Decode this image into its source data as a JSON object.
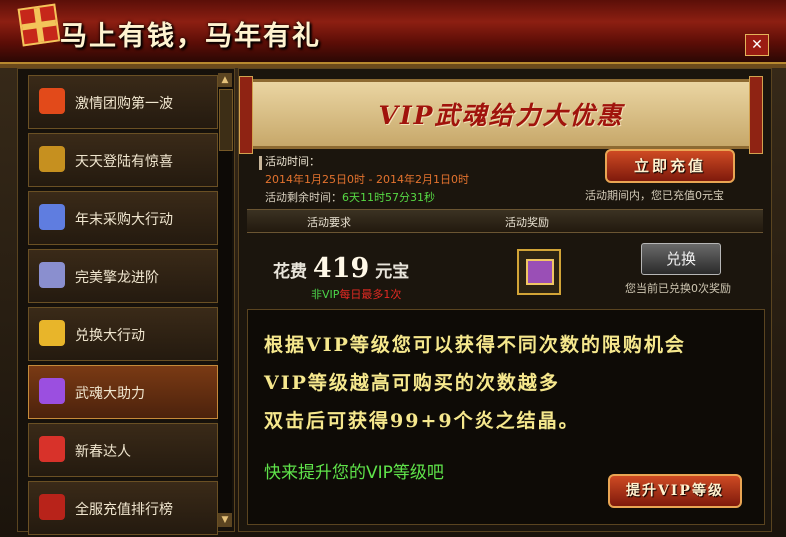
{
  "window": {
    "title": "马上有钱，马年有礼",
    "close_glyph": "✕"
  },
  "sidebar": {
    "items": [
      {
        "label": "激情团购第一波",
        "icon": "group-buy-icon",
        "color": "#e24a1a"
      },
      {
        "label": "天天登陆有惊喜",
        "icon": "star-ribbon-icon",
        "color": "#c6901f"
      },
      {
        "label": "年末采购大行动",
        "icon": "potion-bottle-icon",
        "color": "#5f7de0"
      },
      {
        "label": "完美擎龙进阶",
        "icon": "mage-figure-icon",
        "color": "#8a8fcf"
      },
      {
        "label": "兑换大行动",
        "icon": "gold-ingot-icon",
        "color": "#e8b52a"
      },
      {
        "label": "武魂大助力",
        "icon": "purple-orb-icon",
        "color": "#9b4fe0",
        "active": true
      },
      {
        "label": "新春达人",
        "icon": "red-bag-icon",
        "color": "#d8322a"
      },
      {
        "label": "全服充值排行榜",
        "icon": "red-banner-icon",
        "color": "#b8231a"
      }
    ]
  },
  "banner": {
    "title": "VIP武魂给力大优惠"
  },
  "activity": {
    "time_label": "活动时间：",
    "time_range": "2014年1月25日0时 - 2014年2月1日0时",
    "remain_label": "活动剩余时间：",
    "remain_value": "6天11时57分31秒",
    "recharge_button": "立即充值",
    "recharge_note": "活动期间内，您已充值0元宝"
  },
  "table": {
    "col_requirement": "活动要求",
    "col_reward": "活动奖励",
    "cost_prefix": "花费",
    "cost_value": "419",
    "cost_unit": "元宝",
    "limit_vip": "非VIP",
    "limit_text": "每日最多1次",
    "reward_icon": "treasure-chest-icon",
    "exchange_button": "兑换",
    "exchange_note": "您当前已兑换0次奖励"
  },
  "description": {
    "line1": "根据VIP等级您可以获得不同次数的限购机会",
    "line2": "VIP等级越高可购买的次数越多",
    "line3": "双击后可获得99+9个炎之结晶。",
    "cta": "快来提升您的VIP等级吧",
    "upgrade_button": "提升VIP等级"
  }
}
